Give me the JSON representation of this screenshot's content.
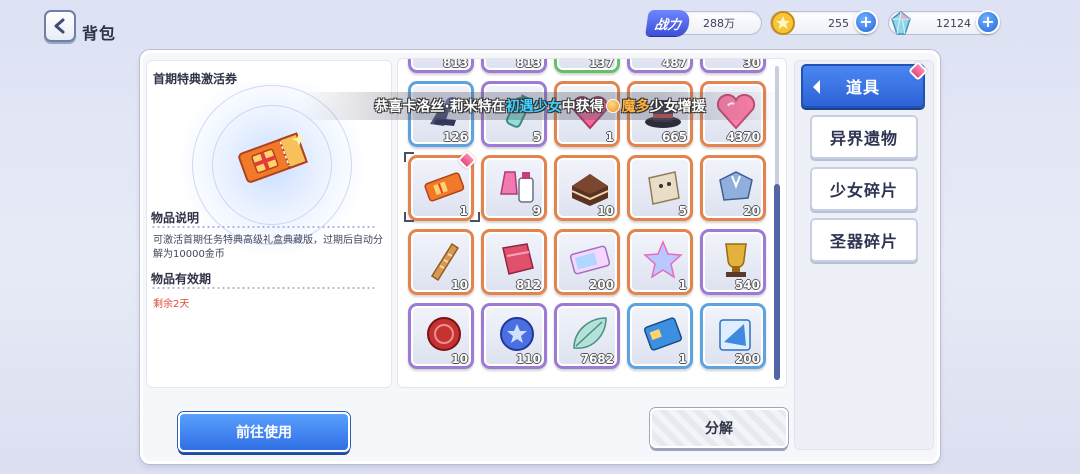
{
  "header": {
    "title": "背包",
    "power_label": "战力",
    "power_value": "288万",
    "coins": "255",
    "gems": "12124"
  },
  "detail": {
    "item_name": "首期特典激活券",
    "desc_title": "物品说明",
    "desc_text": "可激活首期任务特典高级礼盒典藏版，过期后自动分解为10000金币",
    "validity_title": "物品有效期",
    "validity_value": "剩余2天"
  },
  "broadcast": {
    "prefix": "恭喜卡洛丝·莉米特在",
    "activity": "初遇少女",
    "middle": "中获得",
    "item_a": "魔多",
    "item_b": "少女增援"
  },
  "grid": {
    "top_row_counts": [
      "813",
      "137",
      "487",
      "30"
    ],
    "rows": [
      [
        {
          "count": "126",
          "rarity": "blue"
        },
        {
          "count": "5",
          "rarity": "purple"
        },
        {
          "count": "1",
          "rarity": "orange"
        },
        {
          "count": "665",
          "rarity": "orange"
        },
        {
          "count": "4370",
          "rarity": "orange"
        }
      ],
      [
        {
          "count": "1",
          "rarity": "orange"
        },
        {
          "count": "9",
          "rarity": "orange"
        },
        {
          "count": "10",
          "rarity": "orange"
        },
        {
          "count": "5",
          "rarity": "orange"
        },
        {
          "count": "20",
          "rarity": "orange"
        }
      ],
      [
        {
          "count": "10",
          "rarity": "orange"
        },
        {
          "count": "812",
          "rarity": "orange"
        },
        {
          "count": "200",
          "rarity": "orange"
        },
        {
          "count": "1",
          "rarity": "orange"
        },
        {
          "count": "540",
          "rarity": "purple"
        }
      ],
      [
        {
          "count": "10",
          "rarity": "purple"
        },
        {
          "count": "110",
          "rarity": "purple"
        },
        {
          "count": "7682",
          "rarity": "purple"
        },
        {
          "count": "1",
          "rarity": "blue"
        },
        {
          "count": "200",
          "rarity": "blue"
        }
      ]
    ]
  },
  "tabs": [
    "道具",
    "异界遗物",
    "少女碎片",
    "圣器碎片"
  ],
  "buttons": {
    "use": "前往使用",
    "decompose": "分解"
  },
  "colors": {
    "accent_blue": "#2f6fe3",
    "rarity_orange": "#e3834d",
    "rarity_purple": "#9b7bd4",
    "rarity_blue": "#5fa2e0",
    "warning_red": "#e4493a"
  }
}
